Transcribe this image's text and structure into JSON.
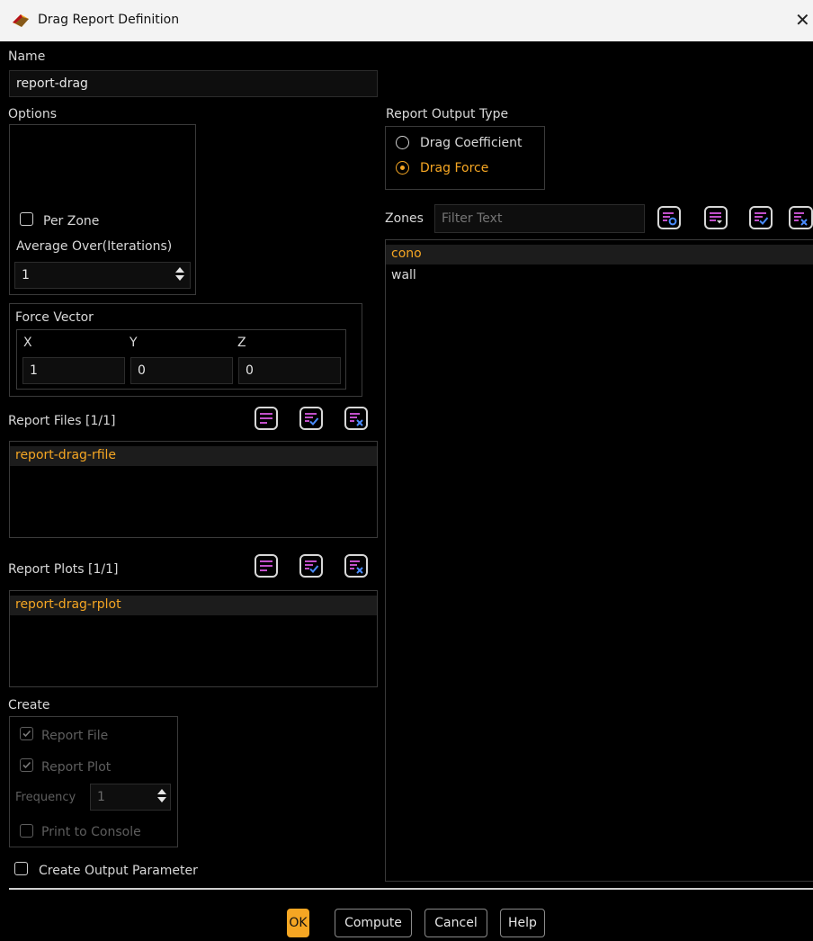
{
  "window": {
    "title": "Drag Report Definition",
    "close_glyph": "✕"
  },
  "name": {
    "label": "Name",
    "value": "report-drag"
  },
  "options": {
    "label": "Options",
    "per_zone": "Per Zone",
    "average_over_label": "Average Over(Iterations)",
    "average_over_value": "1"
  },
  "report_output_type": {
    "label": "Report Output Type",
    "options": [
      "Drag Coefficient",
      "Drag Force"
    ],
    "selected": "Drag Force"
  },
  "force_vector": {
    "label": "Force Vector",
    "x_label": "X",
    "y_label": "Y",
    "z_label": "Z",
    "x": "1",
    "y": "0",
    "z": "0"
  },
  "zones": {
    "label": "Zones",
    "filter_placeholder": "Filter Text",
    "items": [
      "cono",
      "wall"
    ],
    "selected": "cono"
  },
  "report_files": {
    "label": "Report Files [1/1]",
    "items": [
      "report-drag-rfile"
    ]
  },
  "report_plots": {
    "label": "Report Plots [1/1]",
    "items": [
      "report-drag-rplot"
    ]
  },
  "create": {
    "label": "Create",
    "report_file": "Report File",
    "report_plot": "Report Plot",
    "frequency_label": "Frequency",
    "frequency_value": "1",
    "print_to_console": "Print to Console"
  },
  "create_output_parameter": "Create Output Parameter",
  "buttons": {
    "ok": "OK",
    "compute": "Compute",
    "cancel": "Cancel",
    "help": "Help"
  },
  "colors": {
    "accent": "#f5a623",
    "background": "#000000",
    "icon_purple": "#c14fc9",
    "icon_blue": "#4a8cff"
  }
}
